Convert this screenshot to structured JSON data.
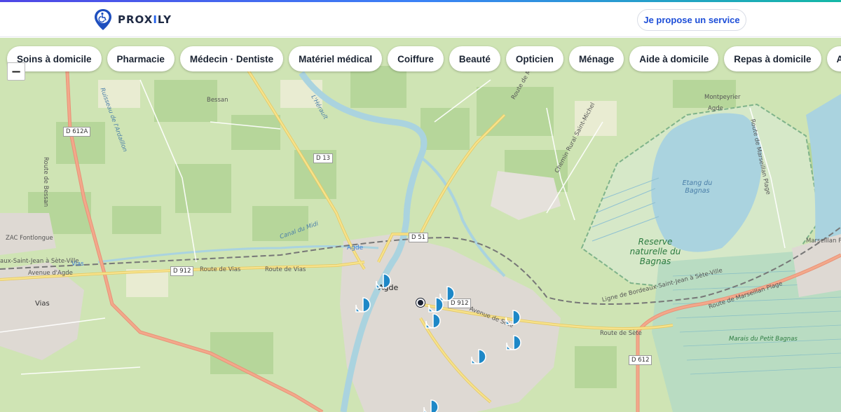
{
  "header": {
    "brand_prefix": "PROX",
    "brand_x": "I",
    "brand_suffix": "LY",
    "propose_button": "Je propose un service"
  },
  "categories": [
    "Soins à domicile",
    "Pharmacie",
    "Médecin · Dentiste",
    "Matériel médical",
    "Coiffure",
    "Beauté",
    "Opticien",
    "Ménage",
    "Aide à domicile",
    "Repas à domicile",
    "Aide admi"
  ],
  "map": {
    "zoom_out_label": "−",
    "labels": {
      "d612a": "D 612A",
      "d13": "D 13",
      "d51": "D 51",
      "d912_west": "D 912",
      "d912_east": "D 912",
      "d612": "D 612",
      "zac": "ZAC Fontlongue",
      "route_de_vias": "Route de Vias",
      "route_de_vias2": "Route de Vias",
      "avenue_agde": "Avenue d'Agde",
      "vias_top": "Vias",
      "vias_town": "Vias",
      "agde_top": "Agde",
      "agde_town": "Agde",
      "bessan": "Bessan",
      "route_de_bessan": "Route de Bessan",
      "ruisseau": "Ruisseau de l'Ardaillon",
      "herault": "L'Hérault",
      "canal_midi": "Canal du Midi",
      "route_marseillan": "Route de Marseillan",
      "chemin_rural": "Chemin Rural Saint-Michel",
      "montpeyrier": "Montpeyrier",
      "agde_ne": "Agde",
      "route_marseillan_plage": "Route de Marseillan Plage",
      "etang": "Etang du Bagnas",
      "reserve": "Reserve naturelle du Bagnas",
      "ligne_sete": "Ligne de Bordeaux-Saint-Jean à Sète-Ville",
      "route_de_sete": "Route de Sète",
      "avenue_sete": "Avenue de Sète",
      "marseillan_plage": "Marseillan Plage",
      "marais": "Marais du Petit Bagnas",
      "route_marseillan_plage2": "Route de Marseillan Plage",
      "laux_saint_jean": "aux-Saint-Jean à Sète-Ville"
    }
  },
  "colors": {
    "accent": "#1d4ed8",
    "marker": "#1e88c7",
    "water": "#aad3df",
    "vineyard": "#b5d29b",
    "road_major": "#f3a88b",
    "road_secondary": "#f6e28c"
  }
}
